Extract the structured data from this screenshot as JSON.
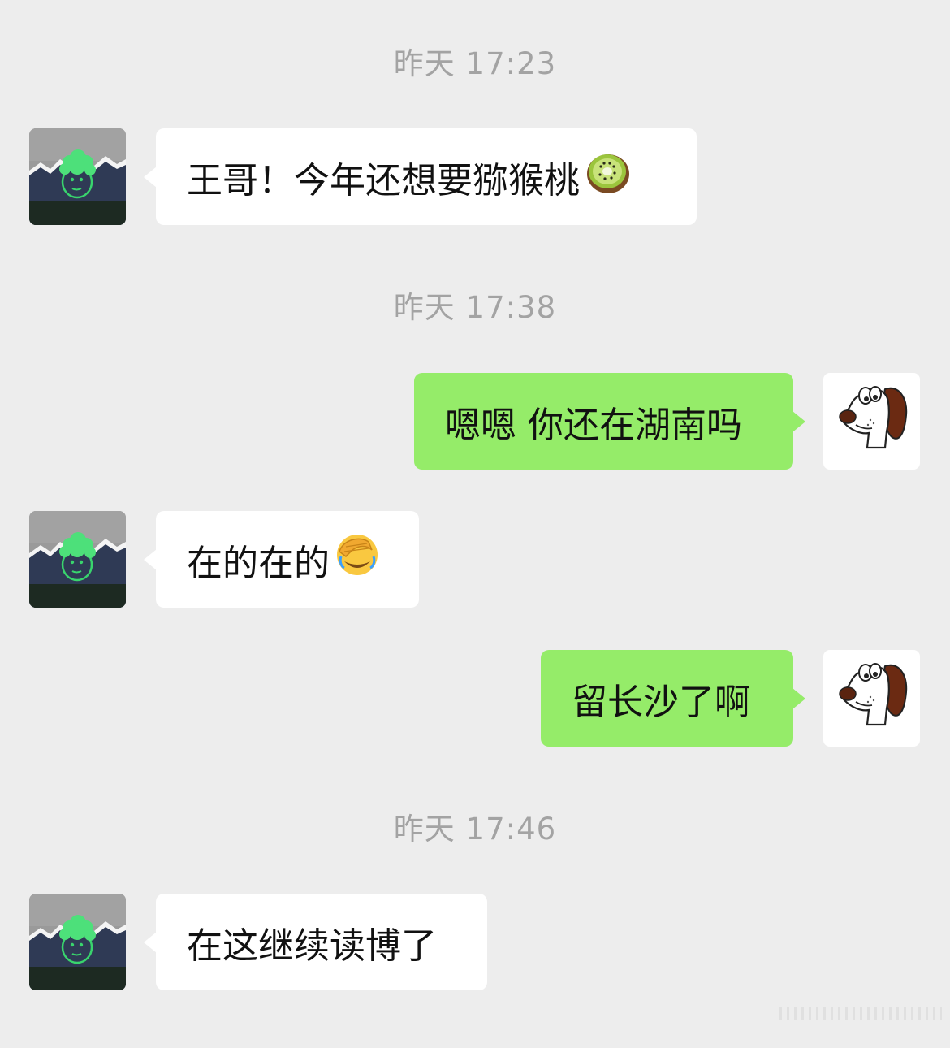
{
  "chat": {
    "timestamps": [
      "昨天 17:23",
      "昨天 17:38",
      "昨天 17:46"
    ],
    "messages": [
      {
        "sender": "contact",
        "text": "王哥！今年还想要猕猴桃",
        "emoji": "kiwi-emoji"
      },
      {
        "sender": "me",
        "text": "嗯嗯 你还在湖南吗"
      },
      {
        "sender": "contact",
        "text": "在的在的",
        "emoji": "face-palm-emoji"
      },
      {
        "sender": "me",
        "text": "留长沙了啊"
      },
      {
        "sender": "contact",
        "text": "在这继续读博了"
      }
    ]
  },
  "theme": {
    "background": "#ededed",
    "incoming_bubble": "#ffffff",
    "outgoing_bubble": "#95ec69",
    "timestamp_color": "#a3a3a3"
  },
  "icons": {
    "contact_avatar": "green-head-mountain-avatar",
    "my_avatar": "cartoon-dog-avatar"
  }
}
